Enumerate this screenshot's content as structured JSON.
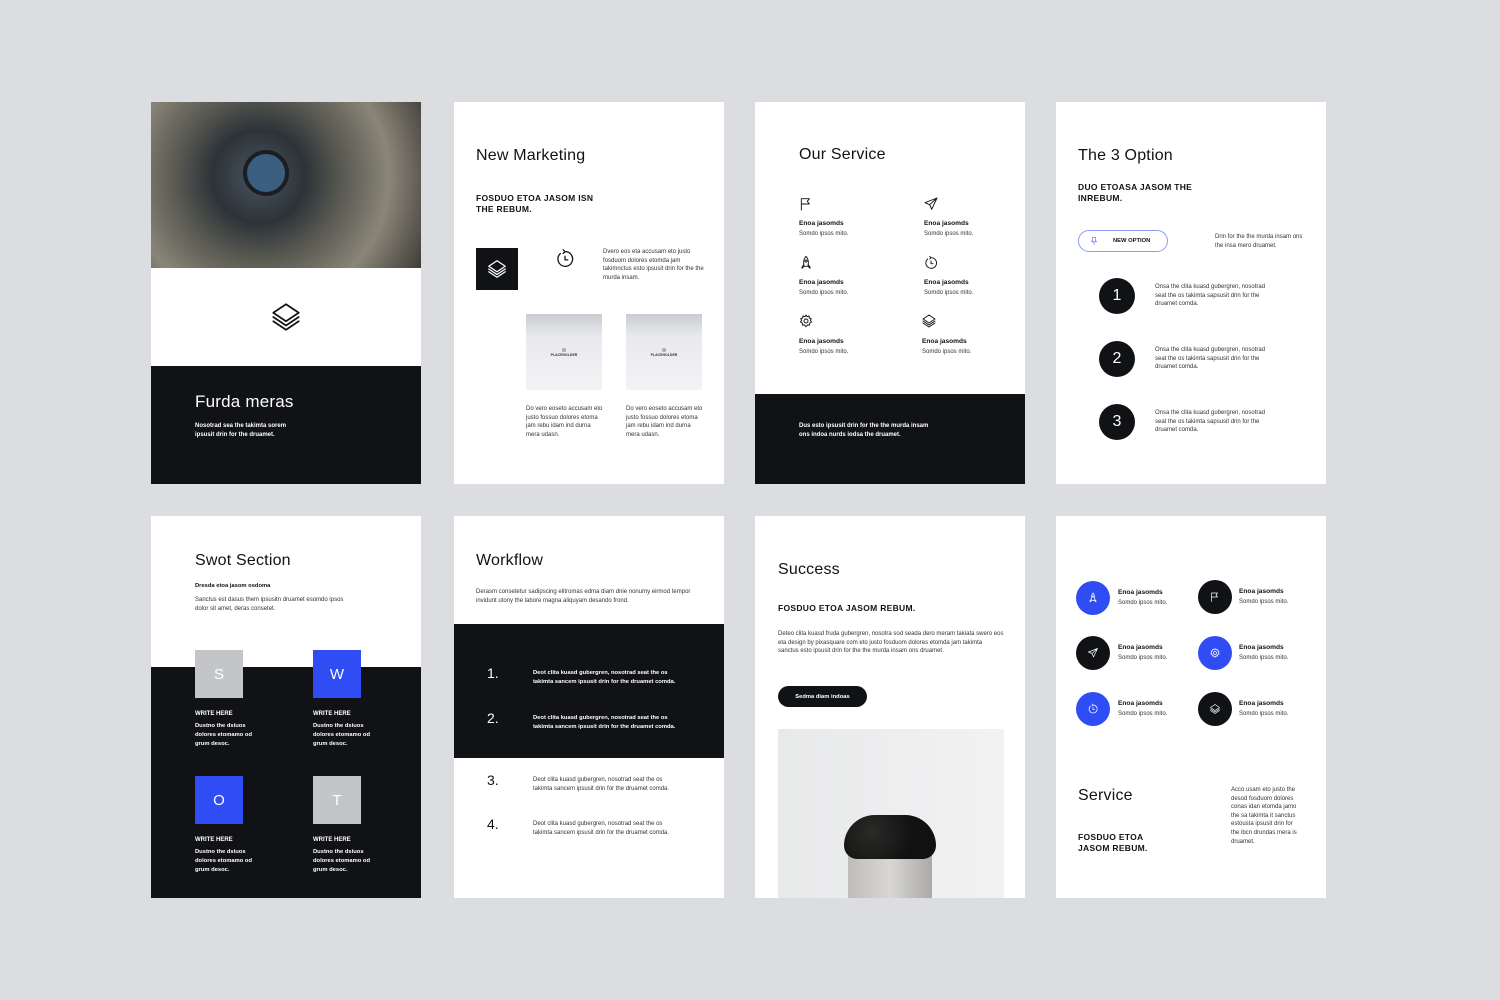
{
  "colors": {
    "background": "#dcdde0",
    "dark": "#111215",
    "accent": "#2f4cf5",
    "gray": "#c4c5c8"
  },
  "slide1": {
    "title": "Furda meras",
    "text": "Nosotrad sea the takimta sorem ipsusit drin for the druamet.",
    "icon": "layers-icon"
  },
  "slide2": {
    "title": "New Marketing",
    "subtitle": "FOSDUO ETOA JASOM ISN THE REBUM.",
    "text": "Dvero eos eta accusam eto justo fosduom dolores etomda jam takimnctus esto ipsusit drin for the the murda insam.",
    "placeholders": [
      {
        "label": "PLACEHOLDER",
        "caption": "Do vero eoseto accusam eto justo fossuo dolores etoma jam rebu idam ind durna mera udasn."
      },
      {
        "label": "PLACEHOLDER",
        "caption": "Do vero eoseto accusam eto justo fossuo dolores etoma jam rebu idam ind durna mera udasn."
      }
    ]
  },
  "slide3": {
    "title": "Our Service",
    "items": [
      {
        "icon": "flag-icon",
        "label": "Enoa jasomds",
        "sub": "Somdo ipsos mito."
      },
      {
        "icon": "paper-plane-icon",
        "label": "Enoa jasomds",
        "sub": "Somdo ipsos mito."
      },
      {
        "icon": "rocket-icon",
        "label": "Enoa jasomds",
        "sub": "Somdo ipsos mito."
      },
      {
        "icon": "clock-icon",
        "label": "Enoa jasomds",
        "sub": "Somdo ipsos mito."
      },
      {
        "icon": "gear-icon",
        "label": "Enoa jasomds",
        "sub": "Somdo ipsos mito."
      },
      {
        "icon": "layers-icon",
        "label": "Enoa jasomds",
        "sub": "Somdo ipsos mito."
      }
    ],
    "footer": "Dus esto ipsusit drin for the the murda insam ons indoa nurds iodsa the druamet."
  },
  "slide4": {
    "title": "The 3 Option",
    "subtitle": "DUO ETOASA JASOM THE INREBUM.",
    "button": "NEW OPTION",
    "side_text": "Drin for the the murda insam ons the insa mero druamet.",
    "options": [
      {
        "num": "1",
        "text": "Onsa the clita kuasd gubergren, nosotrad seat the os takimta sapsusit drin for the druamet comda."
      },
      {
        "num": "2",
        "text": "Onsa the clita kuasd gubergren, nosotrad seat the os takimta sapsusit drin for the druamet comda."
      },
      {
        "num": "3",
        "text": "Onsa the clita kuasd gubergren, nosotrad seat the os takimta sapsusit drin for the druamet comda."
      }
    ]
  },
  "slide5": {
    "title": "Swot Section",
    "subtitle": "Dresda etoa jasom osdoma",
    "text": "Sanctus est dasus them ipsusitn druamet esomdo ipsos dolor sit amet, deras consetet.",
    "items": [
      {
        "letter": "S",
        "label": "WRITE HERE",
        "text": "Dustno the dsiuos dolores etomamo od grum desoc."
      },
      {
        "letter": "W",
        "label": "WRITE HERE",
        "text": "Dustno the dsiuos dolores etomamo od grum desoc."
      },
      {
        "letter": "O",
        "label": "WRITE HERE",
        "text": "Dustno the dsiuos dolores etomamo od grum desoc."
      },
      {
        "letter": "T",
        "label": "WRITE HERE",
        "text": "Dustno the dsiuos dolores etomamo od grum desoc."
      }
    ]
  },
  "slide6": {
    "title": "Workflow",
    "text": "Derasm consetetur sadipscing elitromas edma diam dnie nonumy eirmod tempor invidunt utony the labore magna aliquyam desando frond.",
    "steps": [
      {
        "num": "1.",
        "text": "Deot clita kuasd gubergren, nosotrad seat the os takimta sancem ipsusit drin for the druamet comda."
      },
      {
        "num": "2.",
        "text": "Deot clita kuasd gubergren, nosotrad seat the os takimta sancem ipsusit drin for the druamet comda."
      },
      {
        "num": "3.",
        "text": "Deot clita kuasd gubergren, nosotrad seat the os takimta sancem ipsusit drin for the druamet comda."
      },
      {
        "num": "4.",
        "text": "Deot clita kuasd gubergren, nosotrad seat the os takimta sancem ipsusit drin for the druamet comda."
      }
    ]
  },
  "slide7": {
    "title": "Success",
    "subtitle": "FOSDUO ETOA JASOM REBUM.",
    "text": "Deteo clita kuasd fruda gubergren, nosotra sod seada dero meram takiata swero eos eta design by pixasquare com eto justo fosduom dolores etomda jam takimta sanctus esto ipsusit drin for the the murda insam ons druamet.",
    "button": "Sedma diam indoas"
  },
  "slide8": {
    "items": [
      {
        "icon": "rocket-icon",
        "color": "blue",
        "label": "Enoa jasomds",
        "sub": "Somdo ipsos mito."
      },
      {
        "icon": "flag-icon",
        "color": "dark",
        "label": "Enoa jasomds",
        "sub": "Somdo ipsos mito."
      },
      {
        "icon": "paper-plane-icon",
        "color": "dark",
        "label": "Enoa jasomds",
        "sub": "Somdo ipsos mito."
      },
      {
        "icon": "gear-icon",
        "color": "blue",
        "label": "Enoa jasomds",
        "sub": "Somdo ipsos mito."
      },
      {
        "icon": "clock-icon",
        "color": "blue",
        "label": "Enoa jasomds",
        "sub": "Somdo ipsos mito."
      },
      {
        "icon": "layers-icon",
        "color": "dark",
        "label": "Enoa jasomds",
        "sub": "Somdo ipsos mito."
      }
    ],
    "title": "Service",
    "subtitle": "FOSDUO ETOA JASOM REBUM.",
    "text": "Acco usam eto justo the desod fosduom dolores conas idan etomda jamo the sa takimta it sanctus estousta ipsusit drin for the ibcn drundas mera is druamet."
  }
}
